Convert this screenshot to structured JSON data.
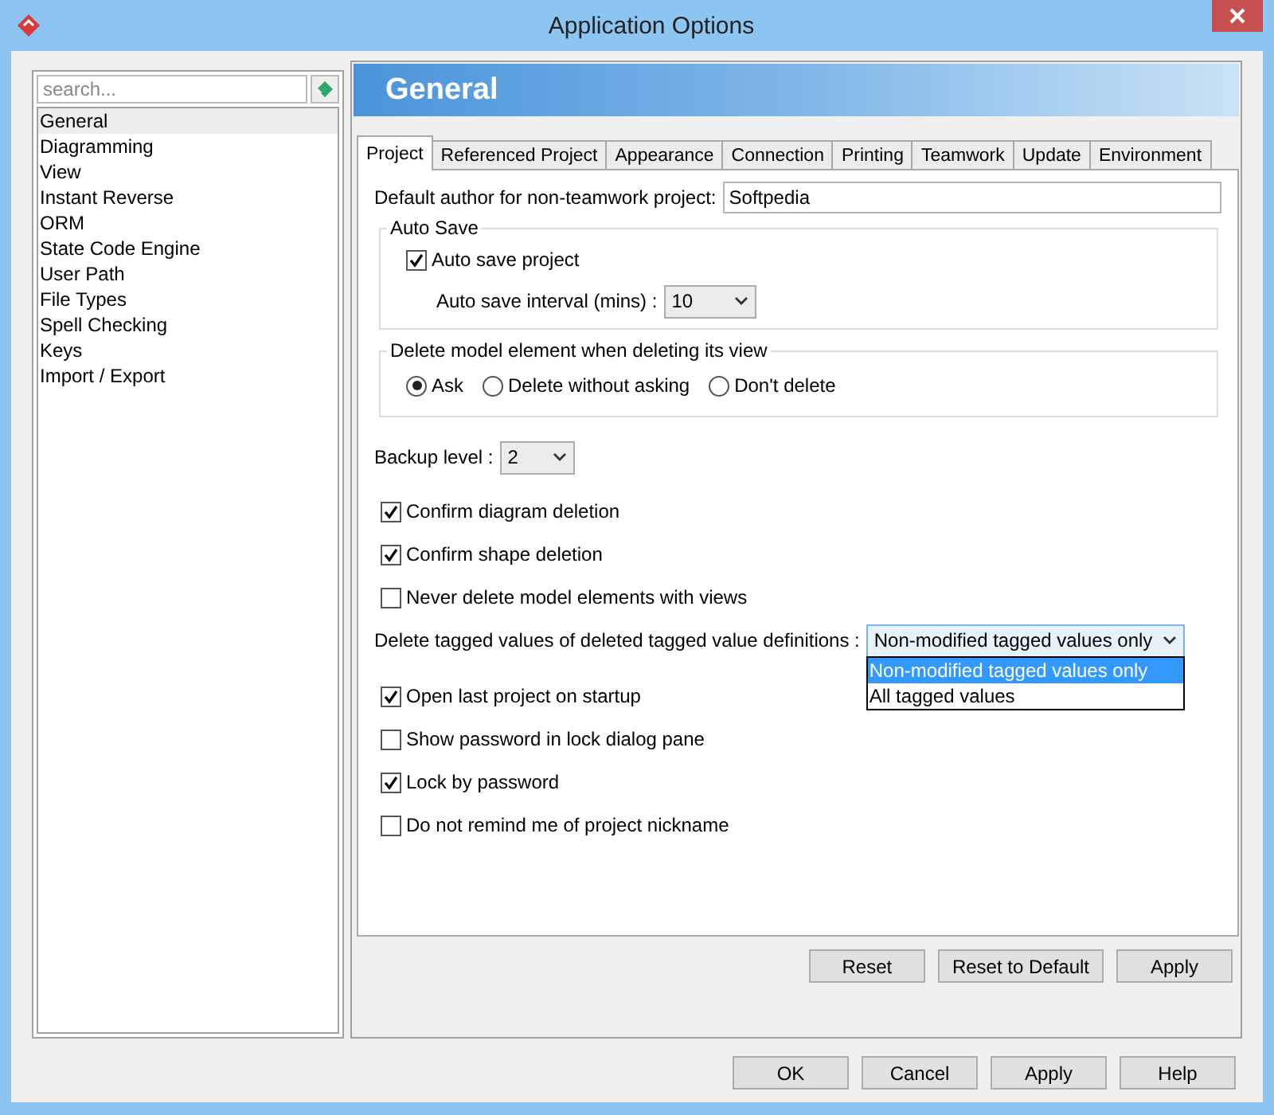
{
  "window": {
    "title": "Application Options"
  },
  "sidebar": {
    "search": {
      "placeholder": "search..."
    },
    "items": [
      {
        "label": "General",
        "selected": true
      },
      {
        "label": "Diagramming",
        "selected": false
      },
      {
        "label": "View",
        "selected": false
      },
      {
        "label": "Instant Reverse",
        "selected": false
      },
      {
        "label": "ORM",
        "selected": false
      },
      {
        "label": "State Code Engine",
        "selected": false
      },
      {
        "label": "User Path",
        "selected": false
      },
      {
        "label": "File Types",
        "selected": false
      },
      {
        "label": "Spell Checking",
        "selected": false
      },
      {
        "label": "Keys",
        "selected": false
      },
      {
        "label": "Import / Export",
        "selected": false
      }
    ]
  },
  "header": {
    "title": "General"
  },
  "tabs": [
    {
      "label": "Project",
      "selected": true
    },
    {
      "label": "Referenced Project",
      "selected": false
    },
    {
      "label": "Appearance",
      "selected": false
    },
    {
      "label": "Connection",
      "selected": false
    },
    {
      "label": "Printing",
      "selected": false
    },
    {
      "label": "Teamwork",
      "selected": false
    },
    {
      "label": "Update",
      "selected": false
    },
    {
      "label": "Environment",
      "selected": false
    }
  ],
  "author_field": {
    "label": "Default author for non-teamwork project:",
    "value": "Softpedia"
  },
  "auto_save": {
    "title": "Auto Save",
    "checkbox": {
      "label": "Auto save project",
      "checked": true
    },
    "interval": {
      "label": "Auto save interval (mins) :",
      "value": "10"
    }
  },
  "delete_group": {
    "title": "Delete model element when deleting its view",
    "radios": [
      {
        "label": "Ask",
        "selected": true
      },
      {
        "label": "Delete without asking",
        "selected": false
      },
      {
        "label": "Don't delete",
        "selected": false
      }
    ]
  },
  "backup": {
    "label": "Backup level :",
    "value": "2"
  },
  "options": [
    {
      "kind": "checkbox",
      "label": "Confirm diagram deletion",
      "checked": true
    },
    {
      "kind": "checkbox",
      "label": "Confirm shape deletion",
      "checked": true
    },
    {
      "kind": "checkbox",
      "label": "Never delete model elements with views",
      "checked": false
    },
    {
      "kind": "combo",
      "label": "Delete tagged values of deleted tagged value definitions :",
      "value": "Non-modified tagged values only",
      "expanded": true,
      "choices": [
        {
          "label": "Non-modified tagged values only",
          "selected": true
        },
        {
          "label": "All tagged values",
          "selected": false
        }
      ]
    },
    {
      "kind": "checkbox",
      "label": "Open last project on startup",
      "checked": true
    },
    {
      "kind": "checkbox",
      "label": "Show password in lock dialog pane",
      "checked": false
    },
    {
      "kind": "checkbox",
      "label": "Lock by password",
      "checked": true
    },
    {
      "kind": "checkbox",
      "label": "Do not remind me of project nickname",
      "checked": false
    }
  ],
  "panel_buttons": [
    "Reset",
    "Reset to Default",
    "Apply"
  ],
  "dialog_buttons": [
    "OK",
    "Cancel",
    "Apply",
    "Help"
  ]
}
